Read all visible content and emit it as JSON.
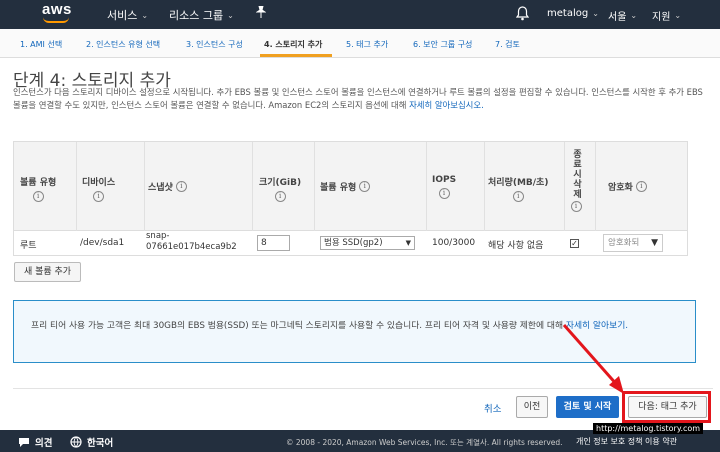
{
  "nav": {
    "logo": "aws",
    "services": "서비스",
    "resource_groups": "리소스 그룹",
    "pin_icon": "pin-icon",
    "account": "metalog",
    "region": "서울",
    "support": "지원"
  },
  "steps": [
    {
      "label": "1. AMI 선택"
    },
    {
      "label": "2. 인스턴스 유형 선택"
    },
    {
      "label": "3. 인스턴스 구성"
    },
    {
      "label": "4. 스토리지 추가"
    },
    {
      "label": "5. 태그 추가"
    },
    {
      "label": "6. 보안 그룹 구성"
    },
    {
      "label": "7. 검토"
    }
  ],
  "page": {
    "title": "단계 4: 스토리지 추가",
    "description": "인스턴스가 다음 스토리지 디바이스 설정으로 시작됩니다. 추가 EBS 볼륨 및 인스턴스 스토어 볼륨을 인스턴스에 연결하거나 루트 볼륨의 설정을 편집할 수 있습니다. 인스턴스를 시작한 후 추가 EBS 볼륨을 연결할 수도 있지만, 인스턴스 스토어 볼륨은 연결할 수 없습니다. Amazon EC2의 스토리지 옵션에 대해 ",
    "description_link": "자세히 알아보십시오."
  },
  "table": {
    "headers": {
      "volume_type": "볼륨 유형",
      "device": "디바이스",
      "snapshot": "스냅샷",
      "size": "크기(GiB)",
      "vol_kind": "볼륨 유형",
      "iops": "IOPS",
      "throughput": "처리량(MB/초)",
      "delete_on_term": "종료 시 삭제",
      "encryption": "암호화"
    },
    "row": {
      "volume_type": "루트",
      "device": "/dev/sda1",
      "snapshot_line1": "snap-",
      "snapshot_line2": "07661e017b4eca9b2",
      "size": "8",
      "vol_kind": "범용 SSD(gp2)",
      "iops": "100/3000",
      "throughput": "해당 사항 없음",
      "delete_checked": "✓",
      "encryption": "암호화되"
    }
  },
  "add_volume": "새 볼륨 추가",
  "notice": {
    "text": "프리 티어 사용 가능 고객은 최대 30GB의 EBS 범용(SSD) 또는 마그네틱 스토리지를 사용할 수 있습니다. 프리 티어 자격 및 사용량 제한에 대해 ",
    "link": "자세히 알아보기."
  },
  "buttons": {
    "cancel": "취소",
    "prev": "이전",
    "review_launch": "검토 및 시작",
    "next": "다음: 태그 추가"
  },
  "footer": {
    "feedback": "의견",
    "language": "한국어",
    "copyright": "© 2008 - 2020, Amazon Web Services, Inc. 또는 계열사. All rights reserved.",
    "links": "개인 정보 보호 정책   이용 약관"
  },
  "watermark": "http://metalog.tistory.com",
  "colors": {
    "nav_bg": "#232f3e",
    "accent": "#ff9900",
    "primary_button": "#1e6ec8",
    "highlight": "#e3161c"
  }
}
